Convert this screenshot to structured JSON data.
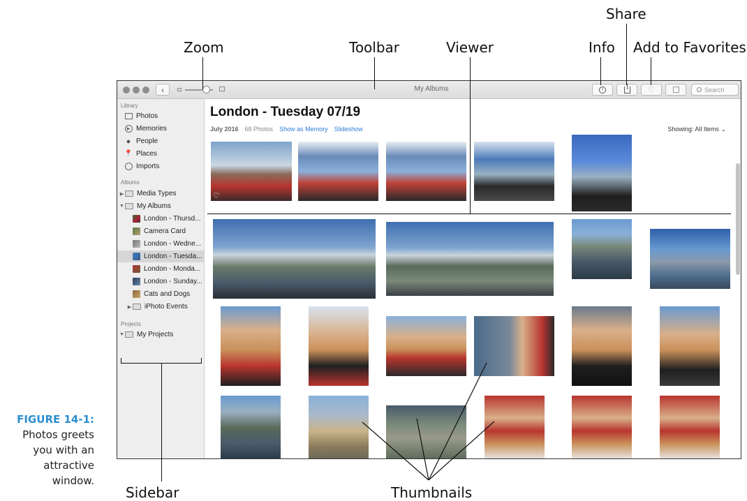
{
  "callouts": {
    "zoom": "Zoom",
    "toolbar": "Toolbar",
    "viewer": "Viewer",
    "info": "Info",
    "share": "Share",
    "add_to_favorites": "Add to Favorites",
    "sidebar": "Sidebar",
    "thumbnails": "Thumbnails"
  },
  "caption": {
    "figure": "FIGURE 14-1:",
    "text_lines": [
      "Photos greets",
      "you with an",
      "attractive",
      "window."
    ]
  },
  "window": {
    "title": "My Albums",
    "search_placeholder": "Search",
    "icons": [
      "back-icon",
      "zoom-small-icon",
      "zoom-large-icon",
      "info-icon",
      "share-icon",
      "heart-icon",
      "rotate-icon",
      "search-icon"
    ]
  },
  "sidebar": {
    "library_label": "Library",
    "library_items": [
      {
        "label": "Photos",
        "icon": "photos-icon"
      },
      {
        "label": "Memories",
        "icon": "memories-icon"
      },
      {
        "label": "People",
        "icon": "people-icon"
      },
      {
        "label": "Places",
        "icon": "places-icon"
      },
      {
        "label": "Imports",
        "icon": "imports-icon"
      }
    ],
    "albums_label": "Albums",
    "album_items": [
      {
        "label": "Media Types",
        "icon": "folder-icon",
        "level": 0,
        "disclosure": "collapsed"
      },
      {
        "label": "My Albums",
        "icon": "folder-icon",
        "level": 0,
        "disclosure": "expanded"
      },
      {
        "label": "London - Thursd...",
        "icon": "album-thumb",
        "level": 1
      },
      {
        "label": "Camera Card",
        "icon": "album-thumb",
        "level": 1
      },
      {
        "label": "London - Wedne...",
        "icon": "album-thumb",
        "level": 1
      },
      {
        "label": "London - Tuesda...",
        "icon": "album-thumb",
        "level": 1,
        "selected": true
      },
      {
        "label": "London - Monda...",
        "icon": "album-thumb",
        "level": 1
      },
      {
        "label": "London - Sunday...",
        "icon": "album-thumb",
        "level": 1
      },
      {
        "label": "Cats and Dogs",
        "icon": "album-thumb",
        "level": 1
      },
      {
        "label": "iPhoto Events",
        "icon": "folder-icon",
        "level": 1,
        "disclosure": "collapsed"
      }
    ],
    "projects_label": "Projects",
    "project_items": [
      {
        "label": "My Projects",
        "icon": "folder-icon",
        "level": 0,
        "disclosure": "expanded"
      }
    ]
  },
  "viewer": {
    "heading": "London - Tuesday 07/19",
    "date": "July 2016",
    "count": "68 Photos",
    "show_as_memory": "Show as Memory",
    "slideshow": "Slideshow",
    "showing_label": "Showing:",
    "showing_value": "All Items"
  },
  "colors": {
    "link": "#2f7ad6",
    "figure_label": "#2a8fd0",
    "sidebar_bg": "#eeeeee",
    "selected_row": "#d6d6d6"
  }
}
